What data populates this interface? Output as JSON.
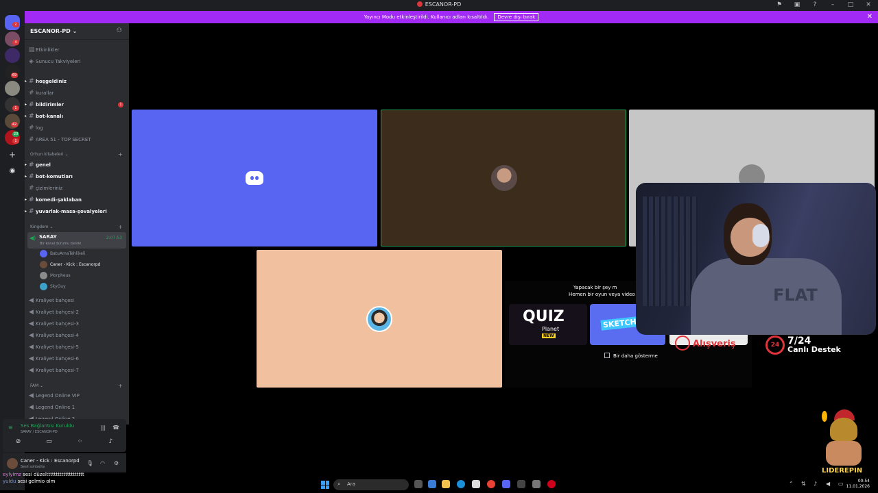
{
  "window": {
    "title": "ESCANOR-PD",
    "controls": [
      "flag-icon",
      "inbox-icon",
      "help-icon",
      "minimize-icon",
      "maximize-icon",
      "close-icon"
    ]
  },
  "banner": {
    "text": "Yayıncı Modu etkinleştirildi. Kullanıcı adları kısaltıldı.",
    "button": "Devre dışı bırak",
    "close": "✕",
    "color": "#a12bf5"
  },
  "rail": {
    "badges": [
      "2",
      "4",
      "69",
      "1",
      "42",
      "20",
      "1"
    ]
  },
  "server": {
    "name": "ESCANOR-PD",
    "chevron": "⌄",
    "top_items": [
      "Etkinlikler",
      "Sunucu Takviyeleri"
    ],
    "channels_1": [
      {
        "name": "hoşgeldiniz",
        "bold": true
      },
      {
        "name": "kurallar",
        "bold": false
      },
      {
        "name": "bildirimler",
        "bold": true,
        "badge": "1"
      },
      {
        "name": "bot-kanalı",
        "bold": true
      },
      {
        "name": "log",
        "bold": false
      },
      {
        "name": "AREA 51 - TOP SECRET",
        "bold": false
      }
    ],
    "category_2": "Orhun kitabeleri",
    "channels_2": [
      {
        "name": "genel",
        "bold": true
      },
      {
        "name": "bot-komutları",
        "bold": true
      },
      {
        "name": "çizimleriniz",
        "bold": false
      },
      {
        "name": "komedi-şaklaban",
        "bold": true
      },
      {
        "name": "yuvarlak-masa-şovalyeleri",
        "bold": true
      }
    ],
    "category_3": "Kingdom",
    "active_voice": {
      "name": "SARAY",
      "status": "Bir kanal durumu belirle",
      "timer": "2:07:53"
    },
    "members": [
      {
        "name": "BatuAmaTehlikeli",
        "color": "#5865f2"
      },
      {
        "name": "Caner - Kick : Escanorpd",
        "color": "#6b4b3a"
      },
      {
        "name": "Morpheus",
        "color": "#8a8a8a"
      },
      {
        "name": "SkyGuy",
        "color": "#3ea0c6"
      }
    ],
    "voice_channels": [
      "Kraliyet bahçesi",
      "Kraliyet bahçesi-2",
      "Kraliyet bahçesi-3",
      "Kraliyet bahçesi-4",
      "Kraliyet bahçesi-5",
      "Kraliyet bahçesi-6",
      "Kraliyet bahçesi-7"
    ],
    "category_4": "FAM",
    "fam_channels": [
      "Legend Online VIP",
      "Legend Online 1",
      "Legend Online 2"
    ]
  },
  "voice_panel": {
    "status": "Ses Bağlantısı Kuruldu",
    "channel": "SARAY / ESCANOR-PD"
  },
  "user": {
    "name": "Caner - Kick : Escanorpd",
    "status": "Sesli sohbette"
  },
  "chat_overlay": [
    {
      "name": "eylyimz",
      "text": "sesi düzeltttttttttttttttttttt"
    },
    {
      "name": "yuldu",
      "text": "sesi gelmio olm"
    }
  ],
  "activity": {
    "line1": "Yapacak bir şey m",
    "line2": "Hemen bir oyun veya video o",
    "cards": [
      {
        "title": "QUIZ",
        "sub": "Planet",
        "tag": "NEW"
      },
      {
        "title": "SKETCHHE"
      }
    ],
    "checkbox": "Bir daha gösterme"
  },
  "overlay_ads": {
    "shop": "Alışveriş",
    "support_big": "7/24",
    "support_small": "Canlı Destek",
    "support_badge": "24"
  },
  "mascot_label": "LIDEREPIN",
  "webcam_shirt": "FLAT",
  "taskbar": {
    "search": "Ara",
    "time": "00:54",
    "date": "11.01.2026"
  }
}
